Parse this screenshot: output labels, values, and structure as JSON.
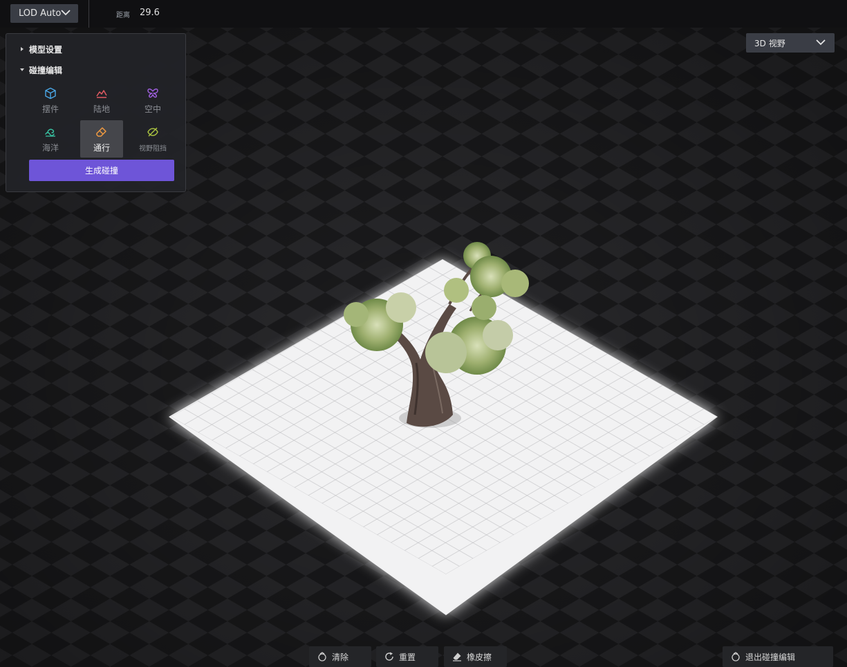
{
  "topbar": {
    "lod_label": "LOD Auto",
    "distance_label": "距离",
    "distance_value": "29.6"
  },
  "view_select": {
    "value": "3D 视野"
  },
  "panel": {
    "section_model": "模型设置",
    "section_collision": "碰撞编辑",
    "tools": [
      {
        "label": "摆件",
        "icon": "cube-icon",
        "color": "#4aa8e8"
      },
      {
        "label": "陆地",
        "icon": "terrain-icon",
        "color": "#e05a62"
      },
      {
        "label": "空中",
        "icon": "butterfly-icon",
        "color": "#a060e0"
      },
      {
        "label": "海洋",
        "icon": "wave-icon",
        "color": "#38c0a0"
      },
      {
        "label": "通行",
        "icon": "eraser-icon",
        "color": "#f09a40"
      },
      {
        "label": "视野阻挡",
        "icon": "eye-off-icon",
        "color": "#a8c040"
      }
    ],
    "active_tool": "通行",
    "generate_label": "生成碰撞"
  },
  "bottom_bar": {
    "clear_label": "清除",
    "reset_label": "重置",
    "eraser_label": "橡皮擦",
    "exit_label": "退出碰撞编辑"
  },
  "colors": {
    "accent": "#6e55d8",
    "panel_bg": "#222327",
    "button_bg": "#3a3d45"
  }
}
